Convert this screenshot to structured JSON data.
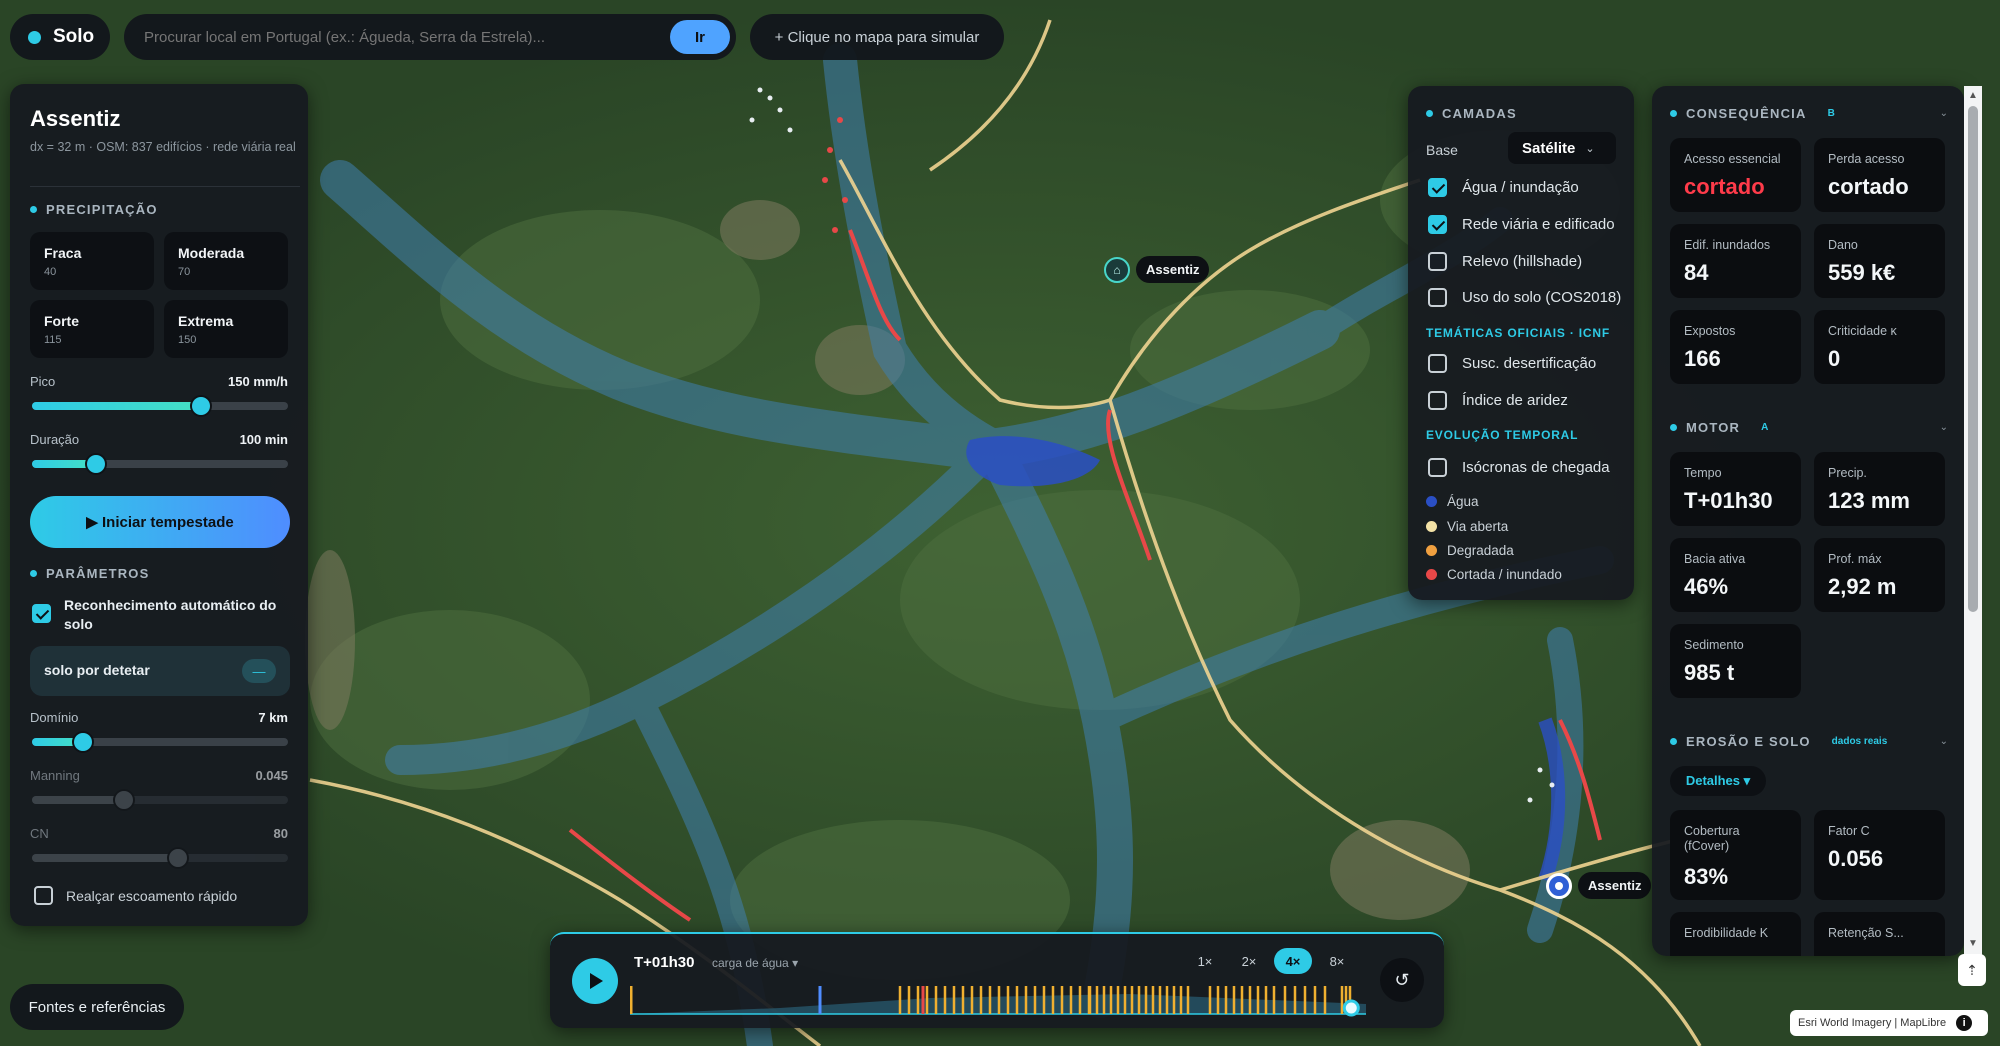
{
  "brand": {
    "name": "Solo"
  },
  "search": {
    "placeholder": "Procurar local em Portugal (ex.: Águeda, Serra da Estrela)...",
    "go_label": "Ir"
  },
  "simulate_hint": "+ Clique no mapa para simular",
  "left": {
    "title": "Assentiz",
    "subtitle": "dx = 32 m · OSM: 837 edifícios · rede viária real",
    "precip_title": "PRECIPITAÇÃO",
    "presets": [
      {
        "name": "Fraca",
        "value": "40"
      },
      {
        "name": "Moderada",
        "value": "70"
      },
      {
        "name": "Forte",
        "value": "115"
      },
      {
        "name": "Extrema",
        "value": "150"
      }
    ],
    "pico": {
      "label": "Pico",
      "value": "150 mm/h",
      "level": 0.66
    },
    "duracao": {
      "label": "Duração",
      "value": "100 min",
      "level": 0.25
    },
    "start_label": "▶ Iniciar tempestade",
    "params_title": "PARÂMETROS",
    "auto_soil_label": "Reconhecimento automático do solo",
    "soil_status": "solo por detetar",
    "soil_toggle": "—",
    "dominio": {
      "label": "Domínio",
      "value": "7 km",
      "level": 0.2
    },
    "manning": {
      "label": "Manning",
      "value": "0.045",
      "level": 0.36
    },
    "cn": {
      "label": "CN",
      "value": "80",
      "level": 0.57
    },
    "fast_runoff_label": "Realçar escoamento rápido"
  },
  "sources_label": "Fontes e referências",
  "layers": {
    "title": "CAMADAS",
    "base_label": "Base",
    "base_value": "Satélite",
    "items": [
      {
        "label": "Água / inundação",
        "checked": true
      },
      {
        "label": "Rede viária e edificado",
        "checked": true
      },
      {
        "label": "Relevo (hillshade)",
        "checked": false
      },
      {
        "label": "Uso do solo (COS2018)",
        "checked": false
      }
    ],
    "thematic_title": "TEMÁTICAS OFICIAIS · ICNF",
    "thematic": [
      {
        "label": "Susc. desertificação",
        "checked": false
      },
      {
        "label": "Índice de aridez",
        "checked": false
      }
    ],
    "temporal_title": "EVOLUÇÃO TEMPORAL",
    "temporal": [
      {
        "label": "Isócronas de chegada",
        "checked": false
      }
    ],
    "legend": [
      {
        "label": "Água",
        "color": "#2a4fc4"
      },
      {
        "label": "Via aberta",
        "color": "#f3e2a6"
      },
      {
        "label": "Degradada",
        "color": "#f0a040"
      },
      {
        "label": "Cortada / inundado",
        "color": "#e84848"
      }
    ]
  },
  "right": {
    "consequencia": {
      "title": "CONSEQUÊNCIA",
      "badge": "B",
      "cards": [
        {
          "k": "Acesso essencial",
          "v": "cortado",
          "red": true
        },
        {
          "k": "Perda acesso",
          "v": "cortado",
          "red": false
        },
        {
          "k": "Edif. inundados",
          "v": "84"
        },
        {
          "k": "Dano",
          "v": "559 k€"
        },
        {
          "k": "Expostos",
          "v": "166"
        },
        {
          "k": "Criticidade κ",
          "v": "0"
        }
      ]
    },
    "motor": {
      "title": "MOTOR",
      "badge": "A",
      "cards": [
        {
          "k": "Tempo",
          "v": "T+01h30"
        },
        {
          "k": "Precip.",
          "v": "123 mm"
        },
        {
          "k": "Bacia ativa",
          "v": "46%"
        },
        {
          "k": "Prof. máx",
          "v": "2,92 m"
        },
        {
          "k": "Sedimento",
          "v": "985 t"
        }
      ]
    },
    "erosao": {
      "title": "EROSÃO E SOLO",
      "badge": "dados reais",
      "details_label": "Detalhes ▾",
      "cards": [
        {
          "k": "Cobertura (fCover)",
          "v": "83%"
        },
        {
          "k": "Fator C",
          "v": "0.056"
        },
        {
          "k": "Erodibilidade K",
          "v": ""
        },
        {
          "k": "Retenção S...",
          "v": ""
        }
      ]
    }
  },
  "timeline": {
    "time": "T+01h30",
    "mode": "carga de água ▾",
    "speeds": [
      "1×",
      "2×",
      "4×",
      "8×"
    ],
    "active_speed": "4×",
    "progress": 0.98
  },
  "map_markers": [
    {
      "label": "Assentiz"
    },
    {
      "label": "Assentiz"
    }
  ],
  "attribution": "Esri World Imagery | MapLibre",
  "colors": {
    "accent": "#2ecbe6",
    "water": "#2a4fc4",
    "cut_road": "#e84848",
    "road": "#f3d38a"
  }
}
